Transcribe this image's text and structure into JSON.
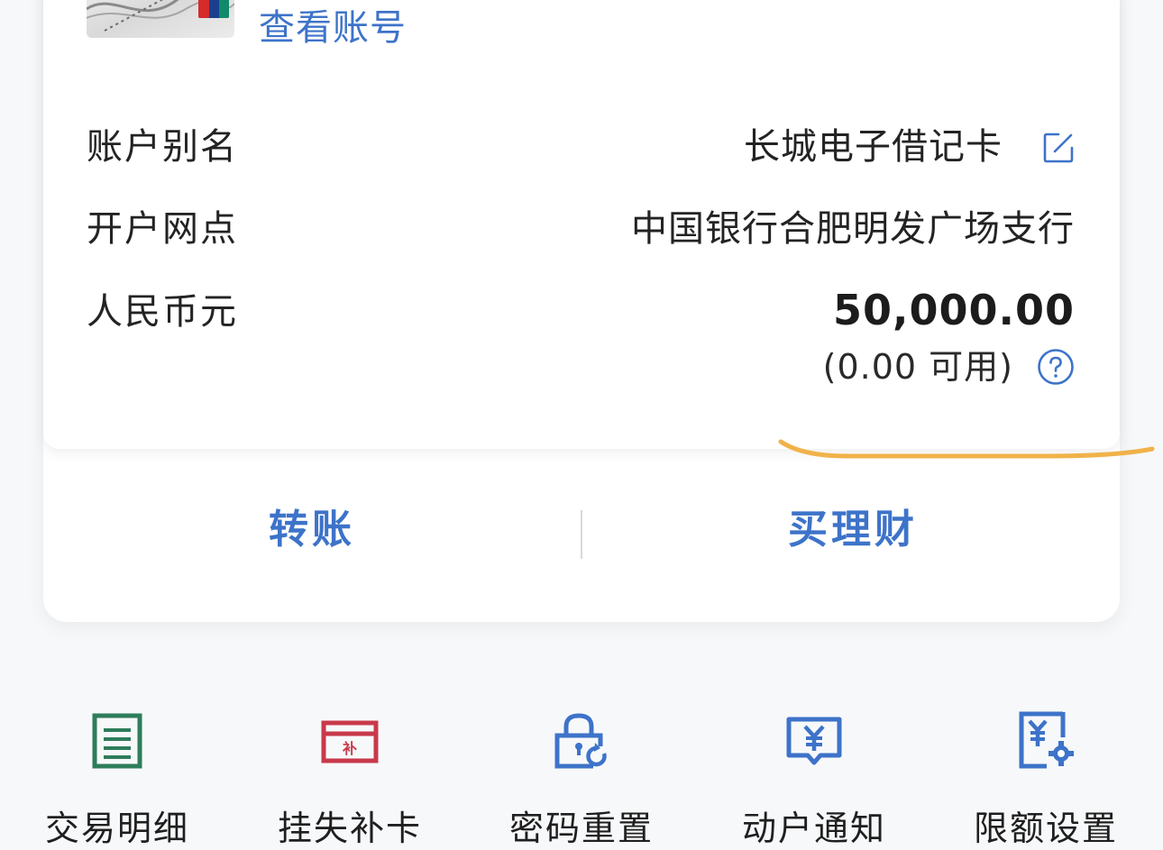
{
  "account_card": {
    "view_account_link": "查看账号",
    "card_thumbnail_icon": "unionpay-card-icon",
    "rows": [
      {
        "label": "账户别名",
        "value": "长城电子借记卡",
        "action_icon": "edit-icon"
      },
      {
        "label": "开户网点",
        "value": "中国银行合肥明发广场支行"
      },
      {
        "label": "人民币元",
        "value": "50,000.00",
        "sub_value": "(0.00 可用)",
        "action_icon": "help-icon"
      }
    ]
  },
  "actions": {
    "transfer": "转账",
    "buy_wealth": "买理财"
  },
  "menu": [
    {
      "label": "交易明细",
      "icon": "transaction-list-icon",
      "color": "#2e7d5b"
    },
    {
      "label": "挂失补卡",
      "icon": "card-replace-icon",
      "color": "#c8394a"
    },
    {
      "label": "密码重置",
      "icon": "password-reset-icon",
      "color": "#3d73c9"
    },
    {
      "label": "动户通知",
      "icon": "account-alert-icon",
      "color": "#3d73c9"
    },
    {
      "label": "限额设置",
      "icon": "limit-settings-icon",
      "color": "#3d73c9"
    }
  ],
  "theme": {
    "accent": "#3d73c9",
    "annotation": "#f0b24a"
  }
}
